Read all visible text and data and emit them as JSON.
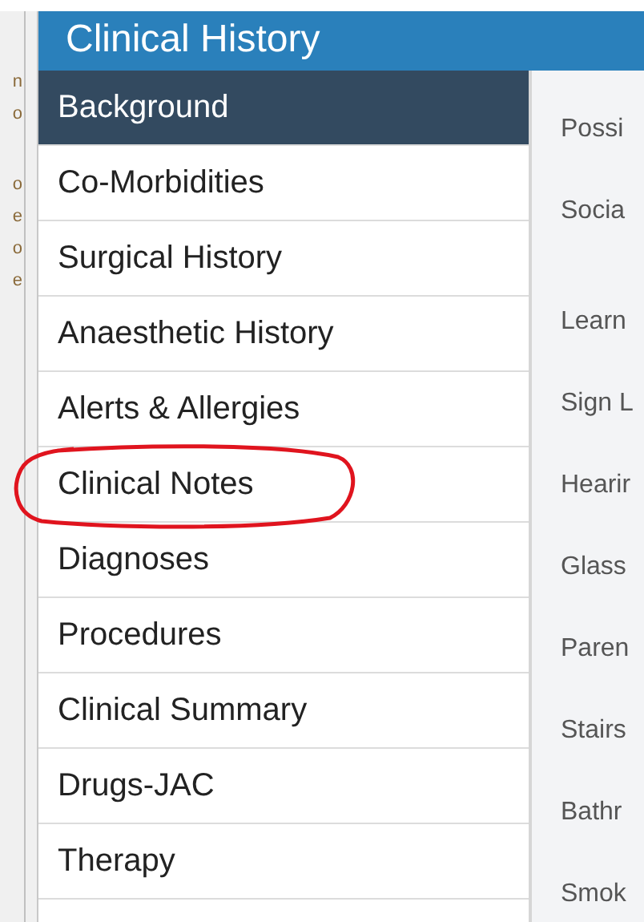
{
  "left_edge_fragments": [
    "n",
    "o",
    "o",
    "e",
    "o",
    "e"
  ],
  "panel": {
    "title": "Clinical History"
  },
  "sidebar": {
    "items": [
      {
        "label": "Background",
        "selected": true,
        "circled": false
      },
      {
        "label": "Co-Morbidities",
        "selected": false,
        "circled": false
      },
      {
        "label": "Surgical History",
        "selected": false,
        "circled": false
      },
      {
        "label": "Anaesthetic History",
        "selected": false,
        "circled": false
      },
      {
        "label": "Alerts & Allergies",
        "selected": false,
        "circled": false
      },
      {
        "label": "Clinical Notes",
        "selected": false,
        "circled": true
      },
      {
        "label": "Diagnoses",
        "selected": false,
        "circled": false
      },
      {
        "label": "Procedures",
        "selected": false,
        "circled": false
      },
      {
        "label": "Clinical Summary",
        "selected": false,
        "circled": false
      },
      {
        "label": "Drugs-JAC",
        "selected": false,
        "circled": false
      },
      {
        "label": "Therapy",
        "selected": false,
        "circled": false
      }
    ]
  },
  "content": {
    "labels": [
      {
        "text": "Possi",
        "kind": "single"
      },
      {
        "text": "Socia",
        "kind": "tall"
      },
      {
        "text": "Learn",
        "kind": "single"
      },
      {
        "text": "Sign L",
        "kind": "single"
      },
      {
        "text": "Hearir",
        "kind": "single"
      },
      {
        "text": "Glass",
        "kind": "single"
      },
      {
        "text": "Paren",
        "kind": "single"
      },
      {
        "text": "Stairs",
        "kind": "single"
      },
      {
        "text": "Bathr",
        "kind": "single"
      },
      {
        "text": "Smok",
        "kind": "single"
      }
    ]
  }
}
